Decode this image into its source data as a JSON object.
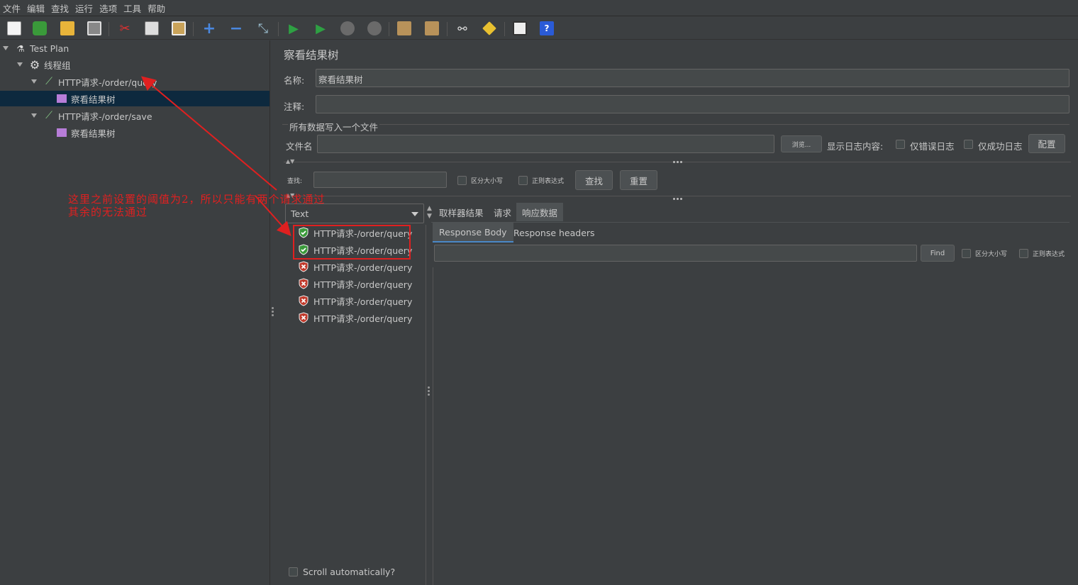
{
  "menu": [
    "文件",
    "编辑",
    "查找",
    "运行",
    "选项",
    "工具",
    "帮助"
  ],
  "toolbar": [
    {
      "icon": "new-icon"
    },
    {
      "icon": "templates-icon"
    },
    {
      "icon": "open-icon"
    },
    {
      "icon": "save-icon"
    },
    {
      "icon": "cut-icon"
    },
    {
      "icon": "copy-icon"
    },
    {
      "icon": "paste-icon"
    },
    {
      "icon": "expand-icon"
    },
    {
      "icon": "collapse-icon"
    },
    {
      "icon": "toggle-icon"
    },
    {
      "icon": "start-icon"
    },
    {
      "icon": "start-no-pauses-icon"
    },
    {
      "icon": "stop-icon"
    },
    {
      "icon": "shutdown-icon"
    },
    {
      "icon": "clear-icon"
    },
    {
      "icon": "clear-all-icon"
    },
    {
      "icon": "search-icon"
    },
    {
      "icon": "reset-search-icon"
    },
    {
      "icon": "function-helper-icon"
    },
    {
      "icon": "help-icon"
    }
  ],
  "tree": {
    "test_plan": "Test Plan",
    "thread_group": "线程组",
    "request1": "HTTP请求-/order/query",
    "listener1": "察看结果树",
    "request2": "HTTP请求-/order/save",
    "listener2": "察看结果树"
  },
  "panel": {
    "title": "察看结果树",
    "name_label": "名称:",
    "name_value": "察看结果树",
    "comment_label": "注释:",
    "comment_value": "",
    "file_section": "所有数据写入一个文件",
    "filename_label": "文件名",
    "filename_value": "",
    "browse": "浏览...",
    "log_label": "显示日志内容:",
    "errors_only": "仅错误日志",
    "success_only": "仅成功日志",
    "configure": "配置",
    "search_label": "查找:",
    "search_value": "",
    "case_sensitive": "区分大小写",
    "regex": "正则表达式",
    "find": "查找",
    "reset": "重置"
  },
  "results": {
    "renderer": "Text",
    "items": [
      {
        "label": "HTTP请求-/order/query",
        "status": "success"
      },
      {
        "label": "HTTP请求-/order/query",
        "status": "success"
      },
      {
        "label": "HTTP请求-/order/query",
        "status": "error"
      },
      {
        "label": "HTTP请求-/order/query",
        "status": "error"
      },
      {
        "label": "HTTP请求-/order/query",
        "status": "error"
      },
      {
        "label": "HTTP请求-/order/query",
        "status": "error"
      }
    ],
    "scroll_auto": "Scroll automatically?"
  },
  "detail": {
    "tabs": [
      "取样器结果",
      "请求",
      "响应数据"
    ],
    "active_tab": "响应数据",
    "subtabs": [
      "Response Body",
      "Response headers"
    ],
    "find_value": "",
    "find_button": "Find",
    "case_sensitive": "区分大小写",
    "regex": "正则表达式"
  },
  "annotation": {
    "line1": "这里之前设置的阈值为2，所以只能有两个请求通过",
    "line2": "其余的无法通过",
    "color": "#e02020"
  },
  "colors": {
    "background": "#3c3f41",
    "selection": "#0d293e",
    "success": "#3a9a3a",
    "error": "#c0392b"
  }
}
